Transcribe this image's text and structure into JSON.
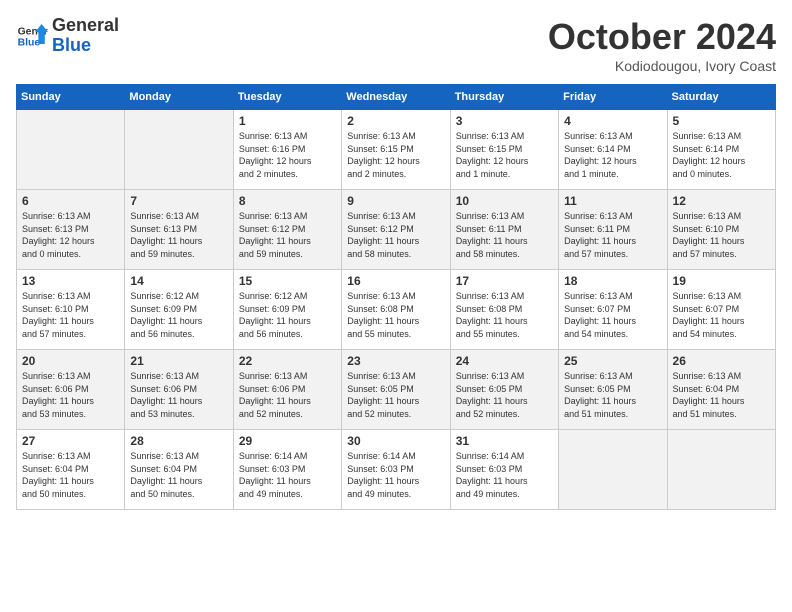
{
  "header": {
    "logo_line1": "General",
    "logo_line2": "Blue",
    "month": "October 2024",
    "location": "Kodiodougou, Ivory Coast"
  },
  "weekdays": [
    "Sunday",
    "Monday",
    "Tuesday",
    "Wednesday",
    "Thursday",
    "Friday",
    "Saturday"
  ],
  "weeks": [
    [
      {
        "day": "",
        "info": ""
      },
      {
        "day": "",
        "info": ""
      },
      {
        "day": "1",
        "info": "Sunrise: 6:13 AM\nSunset: 6:16 PM\nDaylight: 12 hours\nand 2 minutes."
      },
      {
        "day": "2",
        "info": "Sunrise: 6:13 AM\nSunset: 6:15 PM\nDaylight: 12 hours\nand 2 minutes."
      },
      {
        "day": "3",
        "info": "Sunrise: 6:13 AM\nSunset: 6:15 PM\nDaylight: 12 hours\nand 1 minute."
      },
      {
        "day": "4",
        "info": "Sunrise: 6:13 AM\nSunset: 6:14 PM\nDaylight: 12 hours\nand 1 minute."
      },
      {
        "day": "5",
        "info": "Sunrise: 6:13 AM\nSunset: 6:14 PM\nDaylight: 12 hours\nand 0 minutes."
      }
    ],
    [
      {
        "day": "6",
        "info": "Sunrise: 6:13 AM\nSunset: 6:13 PM\nDaylight: 12 hours\nand 0 minutes."
      },
      {
        "day": "7",
        "info": "Sunrise: 6:13 AM\nSunset: 6:13 PM\nDaylight: 11 hours\nand 59 minutes."
      },
      {
        "day": "8",
        "info": "Sunrise: 6:13 AM\nSunset: 6:12 PM\nDaylight: 11 hours\nand 59 minutes."
      },
      {
        "day": "9",
        "info": "Sunrise: 6:13 AM\nSunset: 6:12 PM\nDaylight: 11 hours\nand 58 minutes."
      },
      {
        "day": "10",
        "info": "Sunrise: 6:13 AM\nSunset: 6:11 PM\nDaylight: 11 hours\nand 58 minutes."
      },
      {
        "day": "11",
        "info": "Sunrise: 6:13 AM\nSunset: 6:11 PM\nDaylight: 11 hours\nand 57 minutes."
      },
      {
        "day": "12",
        "info": "Sunrise: 6:13 AM\nSunset: 6:10 PM\nDaylight: 11 hours\nand 57 minutes."
      }
    ],
    [
      {
        "day": "13",
        "info": "Sunrise: 6:13 AM\nSunset: 6:10 PM\nDaylight: 11 hours\nand 57 minutes."
      },
      {
        "day": "14",
        "info": "Sunrise: 6:12 AM\nSunset: 6:09 PM\nDaylight: 11 hours\nand 56 minutes."
      },
      {
        "day": "15",
        "info": "Sunrise: 6:12 AM\nSunset: 6:09 PM\nDaylight: 11 hours\nand 56 minutes."
      },
      {
        "day": "16",
        "info": "Sunrise: 6:13 AM\nSunset: 6:08 PM\nDaylight: 11 hours\nand 55 minutes."
      },
      {
        "day": "17",
        "info": "Sunrise: 6:13 AM\nSunset: 6:08 PM\nDaylight: 11 hours\nand 55 minutes."
      },
      {
        "day": "18",
        "info": "Sunrise: 6:13 AM\nSunset: 6:07 PM\nDaylight: 11 hours\nand 54 minutes."
      },
      {
        "day": "19",
        "info": "Sunrise: 6:13 AM\nSunset: 6:07 PM\nDaylight: 11 hours\nand 54 minutes."
      }
    ],
    [
      {
        "day": "20",
        "info": "Sunrise: 6:13 AM\nSunset: 6:06 PM\nDaylight: 11 hours\nand 53 minutes."
      },
      {
        "day": "21",
        "info": "Sunrise: 6:13 AM\nSunset: 6:06 PM\nDaylight: 11 hours\nand 53 minutes."
      },
      {
        "day": "22",
        "info": "Sunrise: 6:13 AM\nSunset: 6:06 PM\nDaylight: 11 hours\nand 52 minutes."
      },
      {
        "day": "23",
        "info": "Sunrise: 6:13 AM\nSunset: 6:05 PM\nDaylight: 11 hours\nand 52 minutes."
      },
      {
        "day": "24",
        "info": "Sunrise: 6:13 AM\nSunset: 6:05 PM\nDaylight: 11 hours\nand 52 minutes."
      },
      {
        "day": "25",
        "info": "Sunrise: 6:13 AM\nSunset: 6:05 PM\nDaylight: 11 hours\nand 51 minutes."
      },
      {
        "day": "26",
        "info": "Sunrise: 6:13 AM\nSunset: 6:04 PM\nDaylight: 11 hours\nand 51 minutes."
      }
    ],
    [
      {
        "day": "27",
        "info": "Sunrise: 6:13 AM\nSunset: 6:04 PM\nDaylight: 11 hours\nand 50 minutes."
      },
      {
        "day": "28",
        "info": "Sunrise: 6:13 AM\nSunset: 6:04 PM\nDaylight: 11 hours\nand 50 minutes."
      },
      {
        "day": "29",
        "info": "Sunrise: 6:14 AM\nSunset: 6:03 PM\nDaylight: 11 hours\nand 49 minutes."
      },
      {
        "day": "30",
        "info": "Sunrise: 6:14 AM\nSunset: 6:03 PM\nDaylight: 11 hours\nand 49 minutes."
      },
      {
        "day": "31",
        "info": "Sunrise: 6:14 AM\nSunset: 6:03 PM\nDaylight: 11 hours\nand 49 minutes."
      },
      {
        "day": "",
        "info": ""
      },
      {
        "day": "",
        "info": ""
      }
    ]
  ]
}
